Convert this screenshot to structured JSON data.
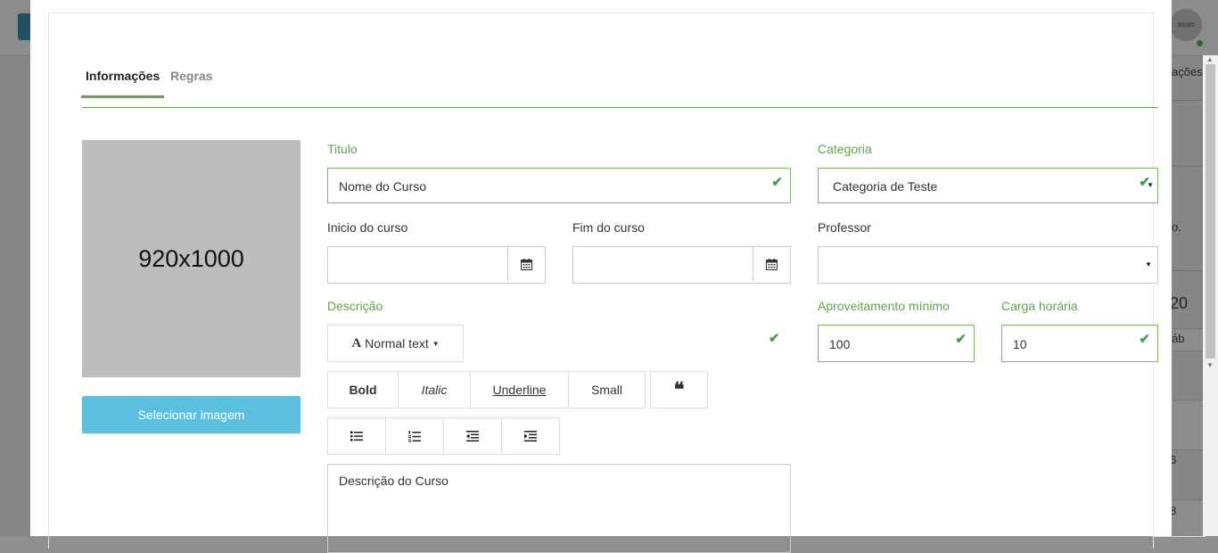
{
  "background": {
    "avatar_text": "80x80",
    "fragments": [
      "ações",
      "o.",
      "20",
      "áb",
      "6",
      "8"
    ]
  },
  "tabs": [
    {
      "label": "Informações",
      "active": true
    },
    {
      "label": "Regras",
      "active": false
    }
  ],
  "image": {
    "placeholder_text": "920x1000",
    "select_button": "Selecionar imagem"
  },
  "form": {
    "titulo": {
      "label": "Titulo",
      "value": "Nome do Curso",
      "valid": true
    },
    "categoria": {
      "label": "Categoria",
      "value": "Categoria de Teste",
      "valid": true
    },
    "inicio": {
      "label": "Inicio do curso",
      "value": ""
    },
    "fim": {
      "label": "Fim do curso",
      "value": ""
    },
    "professor": {
      "label": "Professor",
      "value": ""
    },
    "descricao": {
      "label": "Descrição",
      "value": "Descrição do Curso",
      "valid": true
    },
    "aproveitamento": {
      "label": "Aproveitamento mínimo",
      "value": "100",
      "valid": true
    },
    "carga": {
      "label": "Carga horária",
      "value": "10",
      "valid": true
    }
  },
  "editor": {
    "format_dropdown": "Normal text",
    "buttons": {
      "bold": "Bold",
      "italic": "Italic",
      "underline": "Underline",
      "small": "Small"
    }
  },
  "colors": {
    "accent": "#5ea64a",
    "info_button": "#5bc0de",
    "valid_check": "#43a047"
  }
}
